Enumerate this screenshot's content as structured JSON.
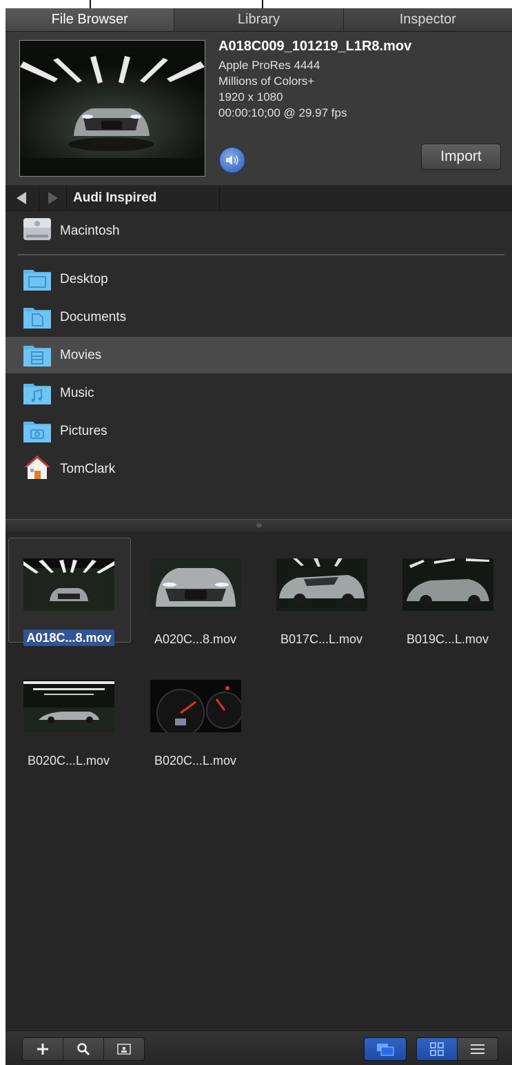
{
  "tabs": [
    {
      "label": "File Browser",
      "active": true
    },
    {
      "label": "Library",
      "active": false
    },
    {
      "label": "Inspector",
      "active": false
    }
  ],
  "preview": {
    "filename": "A018C009_101219_L1R8.mov",
    "codec": "Apple ProRes 4444",
    "color_depth": "Millions of Colors+",
    "resolution": "1920 x 1080",
    "duration": "00:00:10;00 @ 29.97 fps",
    "import_label": "Import",
    "audio_icon": "speaker-icon"
  },
  "pathbar": {
    "current_folder": "Audi Inspired"
  },
  "sources": {
    "volume": {
      "label": "Macintosh",
      "icon": "hard-drive-icon"
    },
    "folders": [
      {
        "label": "Desktop",
        "icon": "desktop-folder-icon",
        "selected": false
      },
      {
        "label": "Documents",
        "icon": "documents-folder-icon",
        "selected": false
      },
      {
        "label": "Movies",
        "icon": "movies-folder-icon",
        "selected": true
      },
      {
        "label": "Music",
        "icon": "music-folder-icon",
        "selected": false
      },
      {
        "label": "Pictures",
        "icon": "pictures-folder-icon",
        "selected": false
      },
      {
        "label": "TomClark",
        "icon": "home-icon",
        "selected": false
      }
    ]
  },
  "files": [
    {
      "label": "A018C...8.mov",
      "selected": true
    },
    {
      "label": "A020C...8.mov",
      "selected": false
    },
    {
      "label": "B017C...L.mov",
      "selected": false
    },
    {
      "label": "B019C...L.mov",
      "selected": false
    },
    {
      "label": "B020C...L.mov",
      "selected": false
    },
    {
      "label": "B020C...L.mov",
      "selected": false
    }
  ],
  "toolbar": {
    "left_buttons": [
      "plus-icon",
      "search-icon",
      "preview-icon"
    ],
    "right_buttons": [
      "stack-icon",
      "grid-view-icon",
      "list-view-icon"
    ]
  },
  "colors": {
    "accent": "#2f5597",
    "panel_bg": "#2b2b2b",
    "selected_row": "#4a4a4a"
  }
}
